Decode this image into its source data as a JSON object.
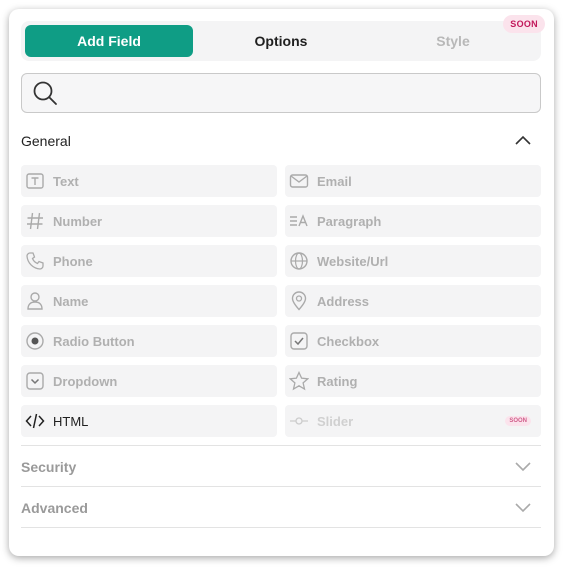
{
  "tabs": {
    "add_field": "Add Field",
    "options": "Options",
    "style": "Style",
    "style_badge": "SOON"
  },
  "search": {
    "placeholder": ""
  },
  "sections": {
    "general": "General",
    "security": "Security",
    "advanced": "Advanced"
  },
  "fields": [
    {
      "label": "Text",
      "icon": "text-icon"
    },
    {
      "label": "Email",
      "icon": "email-icon"
    },
    {
      "label": "Number",
      "icon": "hash-icon"
    },
    {
      "label": "Paragraph",
      "icon": "paragraph-icon"
    },
    {
      "label": "Phone",
      "icon": "phone-icon"
    },
    {
      "label": "Website/Url",
      "icon": "globe-icon"
    },
    {
      "label": "Name",
      "icon": "person-icon"
    },
    {
      "label": "Address",
      "icon": "location-pin-icon"
    },
    {
      "label": "Radio Button",
      "icon": "radio-icon"
    },
    {
      "label": "Checkbox",
      "icon": "checkbox-icon"
    },
    {
      "label": "Dropdown",
      "icon": "dropdown-icon"
    },
    {
      "label": "Rating",
      "icon": "star-icon"
    },
    {
      "label": "HTML",
      "icon": "code-icon"
    },
    {
      "label": "Slider",
      "icon": "slider-icon",
      "badge": "SOON"
    }
  ],
  "colors": {
    "accent": "#0f9d85",
    "badge_bg": "#fbe3ec",
    "badge_text": "#c2185b"
  }
}
